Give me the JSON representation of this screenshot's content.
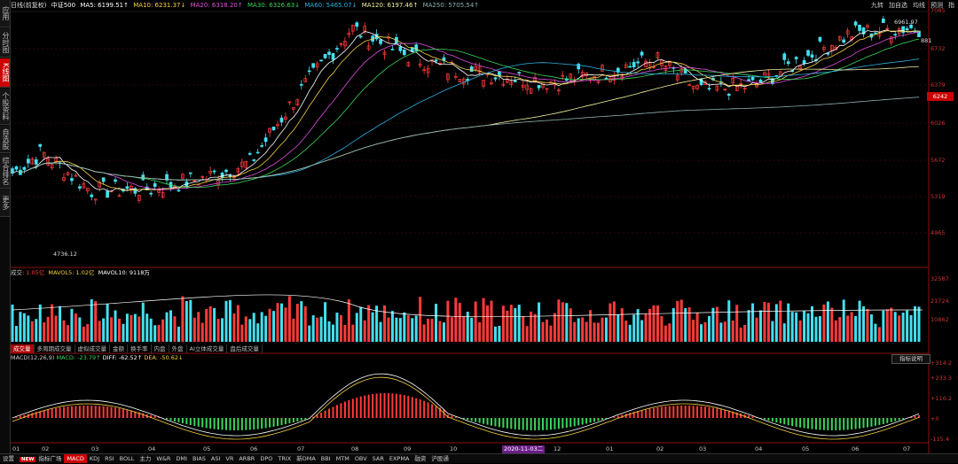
{
  "sidebar": {
    "tabs": [
      {
        "label": "应用",
        "active": false
      },
      {
        "label": "分时图",
        "active": false
      },
      {
        "label": "K线图",
        "active": true
      },
      {
        "label": "个股资料",
        "active": false
      },
      {
        "label": "自选股",
        "active": false
      },
      {
        "label": "综合排名",
        "active": false
      },
      {
        "label": "更多",
        "active": false
      }
    ]
  },
  "topbar": {
    "period": "日线(前复权)",
    "instrument": "中证500",
    "ma5": "MA5: 6199.51↑",
    "ma10": "MA10: 6231.37↓",
    "ma20": "MA20: 6318.20↑",
    "ma30": "MA30: 6326.63↓",
    "ma60": "MA60: 5465.07↓",
    "ma120": "MA120: 6197.46↑",
    "ma250": "MA250: 5705.54↑",
    "right_items": [
      "九转",
      "加自选",
      "均线",
      "预测",
      "指"
    ]
  },
  "price_axis": {
    "labels": [
      "7085",
      "6732",
      "6379",
      "6026",
      "5672",
      "5319",
      "4965"
    ],
    "current_price": "6242",
    "high_label": "6961.97",
    "low_label": "4736.12",
    "right_small": "881"
  },
  "volume": {
    "header_label": "成交",
    "header_value": "1.05亿",
    "mavol5": "MAVOL5: 1.02亿",
    "mavol10": "MAVOL10: 9118万",
    "axis": [
      "32587",
      "21724",
      "10862"
    ]
  },
  "indicator_tabs": [
    "成交量",
    "多周期成交量",
    "虚拟成交量",
    "金额",
    "换手率",
    "内盘",
    "外盘",
    "AI立体成交量",
    "盘后成交量"
  ],
  "macd": {
    "label": "MACD(12,26,9)",
    "macd": "MACD: -23.79↑",
    "diff": "DIFF: -62.52↑",
    "dea": "DEA: -50.62↓",
    "help": "指标说明",
    "axis": [
      "+314.2",
      "+233.3",
      "+116.2",
      "+0",
      "-115.4"
    ]
  },
  "x_axis": {
    "labels": [
      "01",
      "02",
      "03",
      "04",
      "05",
      "06",
      "07",
      "08",
      "09",
      "10",
      "12",
      "01",
      "02",
      "03",
      "04",
      "05",
      "06",
      "07"
    ],
    "date_box": "2020-11-03二"
  },
  "bottom_tabs": {
    "items": [
      "设置",
      "NEW",
      "指标广场",
      "MACD",
      "KDJ",
      "RSI",
      "BOLL",
      "主力",
      "W&R",
      "DMI",
      "BIAS",
      "ASI",
      "VR",
      "ARBR",
      "DPO",
      "TRIX",
      "新DMA",
      "BBI",
      "MTM",
      "OBV",
      "SAR",
      "EXPMA",
      "融资",
      "沪股通"
    ],
    "active": "MACD"
  },
  "colors": {
    "up": "#ff3b3b",
    "down": "#44e0ef",
    "ma5": "#ffffff",
    "ma10": "#f5d142",
    "ma20": "#e04fe0",
    "ma30": "#3bd45a",
    "ma60": "#2fb0e0",
    "ma120": "#f0f0a0",
    "ma250": "#8fb0b0"
  },
  "chart_data": {
    "type": "line",
    "title": "中证500",
    "xlabel": "",
    "ylabel": "",
    "ylim": [
      4736,
      7085
    ],
    "x": [
      "01",
      "02",
      "03",
      "04",
      "05",
      "06",
      "07",
      "08",
      "09",
      "10",
      "12",
      "01",
      "02",
      "03",
      "04",
      "05",
      "06",
      "07"
    ],
    "series": [
      {
        "name": "price",
        "values": [
          5500,
          5700,
          5330,
          5350,
          5450,
          5600,
          6250,
          6900,
          6650,
          6500,
          6380,
          6480,
          6600,
          6300,
          6350,
          6600,
          6850,
          6900
        ]
      }
    ]
  }
}
